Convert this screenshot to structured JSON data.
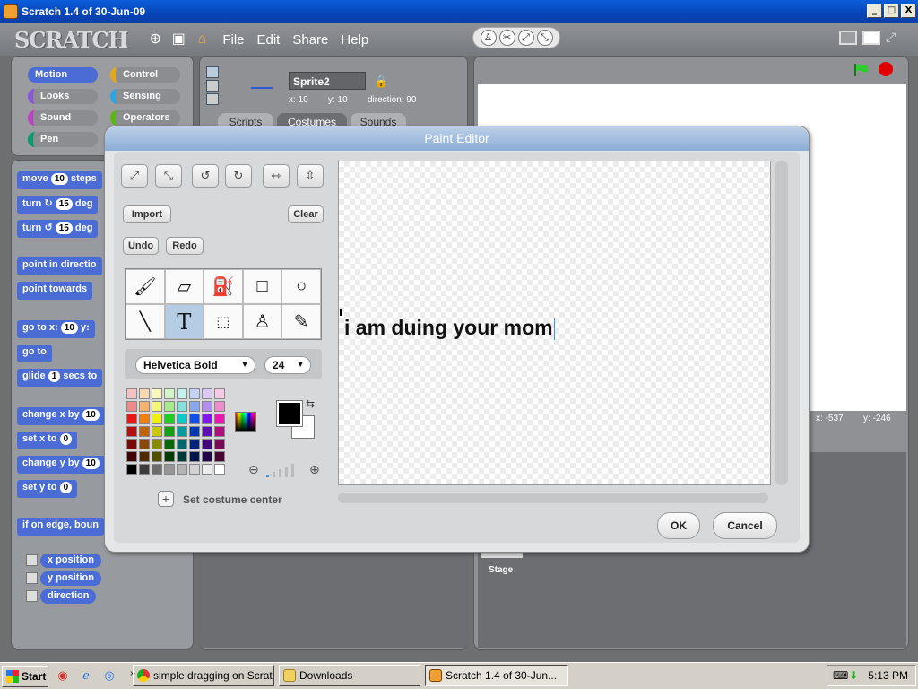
{
  "window": {
    "title": "Scratch 1.4 of 30-Jun-09",
    "buttons": [
      "_",
      "□",
      "X"
    ]
  },
  "menubar": {
    "logo": "SCRATCH",
    "icons": [
      "globe-icon",
      "save-icon",
      "share-icon"
    ],
    "items": [
      "File",
      "Edit",
      "Share",
      "Help"
    ],
    "tools": [
      "stamp-icon",
      "scissors-icon",
      "grow-icon",
      "shrink-icon"
    ]
  },
  "categories": [
    {
      "label": "Motion",
      "color": "#4a6cd4"
    },
    {
      "label": "Control",
      "color": "#e1a91a"
    },
    {
      "label": "Looks",
      "color": "#8a55d7"
    },
    {
      "label": "Sensing",
      "color": "#2ca5e2"
    },
    {
      "label": "Sound",
      "color": "#bb42c3"
    },
    {
      "label": "Operators",
      "color": "#5cb712"
    },
    {
      "label": "Pen",
      "color": "#0e9a6c"
    }
  ],
  "blocks": [
    {
      "text": "move",
      "num": "10",
      "tail": "steps"
    },
    {
      "text": "turn ↻",
      "num": "15",
      "tail": "deg"
    },
    {
      "text": "turn ↺",
      "num": "15",
      "tail": "deg"
    },
    {
      "text": "point in directio",
      "num": "",
      "tail": ""
    },
    {
      "text": "point towards",
      "num": "",
      "tail": ""
    },
    {
      "text": "go to x:",
      "num": "10",
      "tail": "y:"
    },
    {
      "text": "go to",
      "num": "",
      "tail": ""
    },
    {
      "text": "glide",
      "num": "1",
      "tail": "secs to"
    },
    {
      "text": "change x by",
      "num": "10",
      "tail": ""
    },
    {
      "text": "set x to",
      "num": "0",
      "tail": ""
    },
    {
      "text": "change y by",
      "num": "10",
      "tail": ""
    },
    {
      "text": "set y to",
      "num": "0",
      "tail": ""
    },
    {
      "text": "if on edge, boun",
      "num": "",
      "tail": ""
    }
  ],
  "reporters": [
    "x position",
    "y position",
    "direction"
  ],
  "sprite": {
    "name": "Sprite2",
    "x_label": "x:",
    "x": "10",
    "y_label": "y:",
    "y": "10",
    "direction_label": "direction:",
    "direction": "90"
  },
  "tabs": [
    "Scripts",
    "Costumes",
    "Sounds"
  ],
  "stage": {
    "mouse_x_label": "x:",
    "mouse_x": "-537",
    "mouse_y_label": "y:",
    "mouse_y": "-246",
    "thumb_label": "Stage"
  },
  "paint_editor": {
    "title": "Paint Editor",
    "transform_icons": [
      "grow-icon",
      "shrink-icon",
      "rotate-ccw-icon",
      "rotate-cw-icon",
      "flip-horizontal-icon",
      "flip-vertical-icon"
    ],
    "import_label": "Import",
    "clear_label": "Clear",
    "undo_label": "Undo",
    "redo_label": "Redo",
    "tools": [
      "paintbrush-icon",
      "eraser-icon",
      "fill-bucket-icon",
      "rectangle-icon",
      "ellipse-icon",
      "line-icon",
      "text-icon",
      "select-icon",
      "stamp-icon",
      "eyedropper-icon"
    ],
    "selected_tool": "text-icon",
    "font": "Helvetica Bold",
    "font_size": "24",
    "canvas_text": "i am duing your mom",
    "set_center_label": "Set costume center",
    "ok_label": "OK",
    "cancel_label": "Cancel",
    "foreground_color": "#000000",
    "background_color": "#ffffff",
    "palette": [
      "#f4c2c2",
      "#f9d7b0",
      "#fafabe",
      "#d2f5c8",
      "#c6f0ee",
      "#c3d2f5",
      "#dcc8f5",
      "#f5c8e6",
      "#f08a8a",
      "#f5b46e",
      "#f5f57a",
      "#a6ea8e",
      "#88e0dc",
      "#8ca7ec",
      "#b48eec",
      "#ec8ecc",
      "#e81818",
      "#f08010",
      "#f0f010",
      "#20d020",
      "#10c8c8",
      "#1050e8",
      "#8018e8",
      "#e818b0",
      "#b41010",
      "#c06408",
      "#c8c808",
      "#10a010",
      "#089a9a",
      "#0838b0",
      "#6010b0",
      "#b0107e",
      "#7a0808",
      "#8a4804",
      "#8a8a04",
      "#086808",
      "#046868",
      "#04247a",
      "#40087a",
      "#7a0858",
      "#400404",
      "#502a02",
      "#505002",
      "#043a04",
      "#023a3a",
      "#021448",
      "#240448",
      "#480432",
      "#000000",
      "#3c3c3c",
      "#6c6c6c",
      "#969696",
      "#b4b4b4",
      "#d2d2d2",
      "#ececec",
      "#ffffff"
    ]
  },
  "taskbar": {
    "start_label": "Start",
    "tasks": [
      "simple dragging on Scrat...",
      "Downloads",
      "Scratch 1.4 of 30-Jun..."
    ],
    "clock": "5:13 PM"
  }
}
